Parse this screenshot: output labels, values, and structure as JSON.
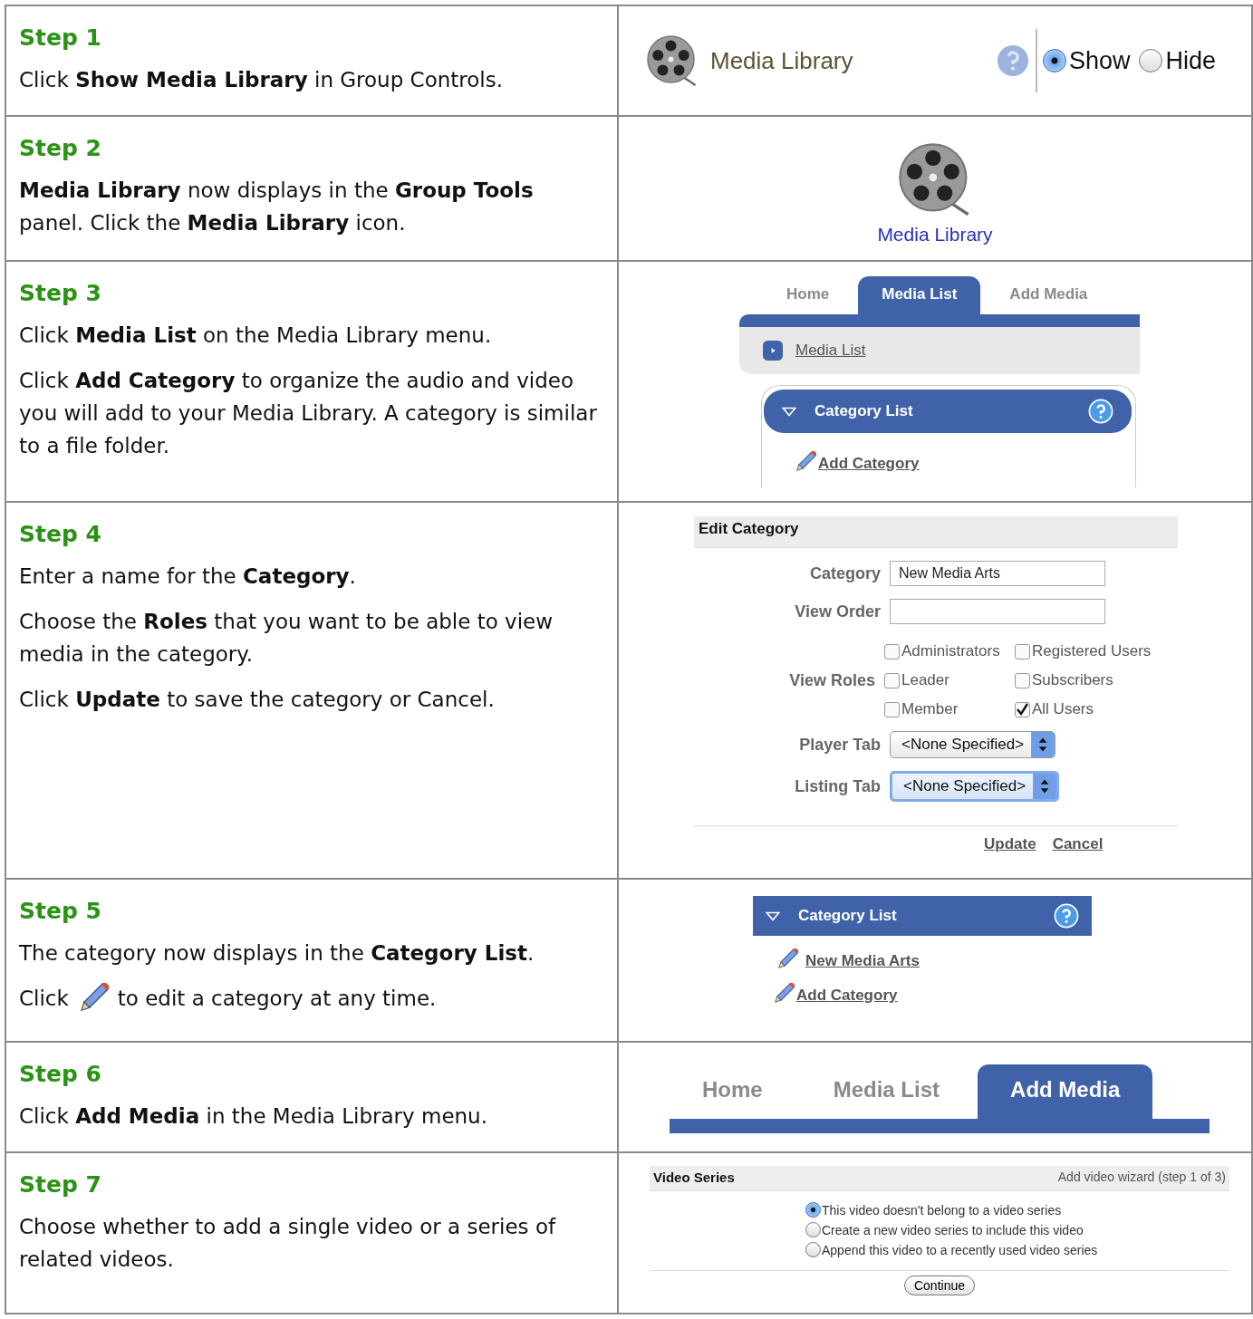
{
  "steps": [
    {
      "title": "Step 1",
      "paragraphs": [
        {
          "kind": "text",
          "text": "Click **Show Media Library** in Group Controls."
        }
      ],
      "panel": {
        "kind": "group_controls",
        "label": "Media Library",
        "options": [
          {
            "label": "Show",
            "selected": true
          },
          {
            "label": "Hide",
            "selected": false
          }
        ]
      }
    },
    {
      "title": "Step 2",
      "paragraphs": [
        {
          "kind": "text",
          "text": "**Media Library** now displays in the **Group Tools** panel. Click the **Media Library** icon."
        }
      ],
      "panel": {
        "kind": "group_tool",
        "label": "Media Library"
      }
    },
    {
      "title": "Step 3",
      "paragraphs": [
        {
          "kind": "text",
          "text": "Click **Media List** on the Media Library menu."
        },
        {
          "kind": "text",
          "text": "Click **Add Category** to organize the audio and video you will add to your Media Library. A category is similar to a file folder."
        }
      ],
      "panel": {
        "kind": "media_menu",
        "tabs": [
          {
            "label": "Home",
            "selected": false
          },
          {
            "label": "Media List",
            "selected": true
          },
          {
            "label": "Add Media",
            "selected": false
          }
        ],
        "submenu": "Media List",
        "box_title": "Category List",
        "links": [
          "Add Category"
        ]
      }
    },
    {
      "title": "Step 4",
      "paragraphs": [
        {
          "kind": "text",
          "text": "Enter a name for the **Category**."
        },
        {
          "kind": "text",
          "text": "Choose the **Roles** that you want to be able to view media in the category."
        },
        {
          "kind": "text",
          "text": "Click **Update** to save the category or Cancel."
        }
      ],
      "panel": {
        "kind": "edit_form",
        "title": "Edit Category",
        "fields": [
          {
            "label": "Category",
            "value": "New Media Arts"
          },
          {
            "label": "View Order"
          }
        ],
        "roles_label": "View Roles",
        "roles": [
          {
            "label": "Administrators",
            "checked": false
          },
          {
            "label": "Registered Users",
            "checked": false
          },
          {
            "label": "Leader",
            "checked": false
          },
          {
            "label": "Subscribers",
            "checked": false
          },
          {
            "label": "Member",
            "checked": false
          },
          {
            "label": "All Users",
            "checked": true
          }
        ],
        "selects": [
          {
            "label": "Player Tab",
            "value": "<None Specified>",
            "focused": false
          },
          {
            "label": "Listing Tab",
            "value": "<None Specified>",
            "focused": true
          }
        ],
        "actions": [
          "Update",
          "Cancel"
        ]
      }
    },
    {
      "title": "Step 5",
      "paragraphs": [
        {
          "kind": "text",
          "text": "The category now displays in the **Category List**."
        },
        {
          "kind": "icon",
          "before": "Click",
          "after": "to edit a category at any time."
        }
      ],
      "panel": {
        "kind": "category_list",
        "box_title": "Category List",
        "links": [
          "New Media Arts",
          "Add Category"
        ]
      }
    },
    {
      "title": "Step 6",
      "paragraphs": [
        {
          "kind": "text",
          "text": "Click **Add Media** in the Media Library menu."
        }
      ],
      "panel": {
        "kind": "tabs_large",
        "tabs": [
          {
            "label": "Home",
            "selected": false
          },
          {
            "label": "Media List",
            "selected": false
          },
          {
            "label": "Add Media",
            "selected": true
          }
        ]
      }
    },
    {
      "title": "Step 7",
      "paragraphs": [
        {
          "kind": "text",
          "text": "Choose whether to add a single video or a series of related videos."
        }
      ],
      "panel": {
        "kind": "video_series",
        "title": "Video Series",
        "wizard": "Add video wizard (step 1 of 3)",
        "options": [
          {
            "label": "This video doesn't belong to a video series",
            "selected": true
          },
          {
            "label": "Create a new video series to include this video",
            "selected": false
          },
          {
            "label": "Append this video to a recently used video series",
            "selected": false
          }
        ],
        "button": "Continue"
      }
    }
  ]
}
